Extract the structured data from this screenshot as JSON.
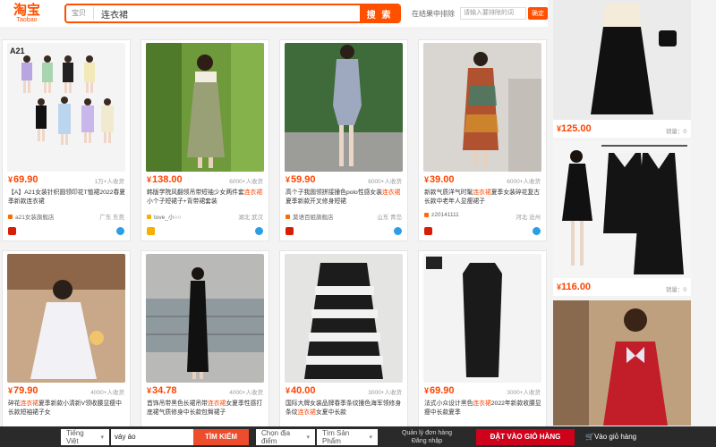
{
  "header": {
    "logo_cn": "淘宝",
    "logo_en": "Taobao",
    "search_scope": "宝贝",
    "search_query": "连衣裙",
    "search_button": "搜 索",
    "exclude_label": "在结果中排除",
    "exclude_placeholder": "请输入要排除的词",
    "exclude_ok": "确定"
  },
  "products": [
    {
      "price": "69.90",
      "paid": "1万+人收货",
      "title_pre": "【A】A21女装针织圆领印花T恤裙2022春",
      "title_hl": "",
      "title_post": "夏季新款连衣裙",
      "shop": "a21女装旗舰店",
      "loc": "广东 东莞"
    },
    {
      "price": "138.00",
      "paid": "6000+人收货",
      "title_pre": "韩版学院风翻领吊带短袖少女两件套",
      "title_hl": "连衣裙",
      "title_post": "小个子短裙子+背带裙套装",
      "shop": "tove_小○○",
      "loc": "湖北 武汉"
    },
    {
      "price": "59.90",
      "paid": "6000+人收货",
      "title_pre": "高个子我圆领拼接撞色polo性感女装",
      "title_hl": "连衣裙",
      "title_post": "夏季新款开叉修身短裙",
      "shop": "莫语百姐旗舰店",
      "loc": "山东 青岛"
    },
    {
      "price": "39.00",
      "paid": "6000+人收货",
      "title_pre": "新款气质洋气时髦",
      "title_hl": "连衣裙",
      "title_post": "夏季女装碎花复古长款中老年人显瘦裙子",
      "shop": "z20141111",
      "loc": "河北 沧州"
    },
    {
      "price": "79.90",
      "paid": "4000+人收货",
      "title_pre": "碎花",
      "title_hl": "连衣裙",
      "title_post": "夏季新款小清新V领收腰显瘦中长款短袖裙子女",
      "shop": "",
      "loc": ""
    },
    {
      "price": "34.78",
      "paid": "4000+人收货",
      "title_pre": "首饰吊带黑色长裙吊带",
      "title_hl": "连衣裙",
      "title_post": "女夏季性感打底裙气质修身中长款包臀裙子",
      "shop": "",
      "loc": ""
    },
    {
      "price": "40.00",
      "paid": "3000+人收货",
      "title_pre": "国际大牌女装品牌春季条纹撞色海军领修身条纹",
      "title_hl": "连衣裙",
      "title_post": "女夏中长款",
      "shop": "",
      "loc": ""
    },
    {
      "price": "69.90",
      "paid": "3000+人收货",
      "title_pre": "法式小众设计黑色",
      "title_hl": "连衣裙",
      "title_post": "2022年新款收腰显瘦中长款夏季",
      "shop": "",
      "loc": ""
    }
  ],
  "right_column": [
    {
      "price": "125.00",
      "sales": "销量：0"
    },
    {
      "price": "116.00",
      "sales": "销量：0"
    },
    {
      "price": "",
      "sales": ""
    }
  ],
  "bottom_bar": {
    "lang": "Tiếng Việt",
    "translation": "váy áo",
    "search_btn": "TÌM KIẾM",
    "select_store": "Chọn địa điểm",
    "select_product": "Tìm Sản Phẩm",
    "manage_line1": "Quản lý đơn hàng",
    "manage_line2": "Đăng nhập",
    "add_cart": "ĐẶT VÀO GIỎ HÀNG",
    "cart_link": "Vào giỏ hàng"
  },
  "colors": {
    "brand": "#ff5000",
    "price": "#ff4400",
    "bar": "#2a2a2a",
    "cart": "#d0011b"
  }
}
